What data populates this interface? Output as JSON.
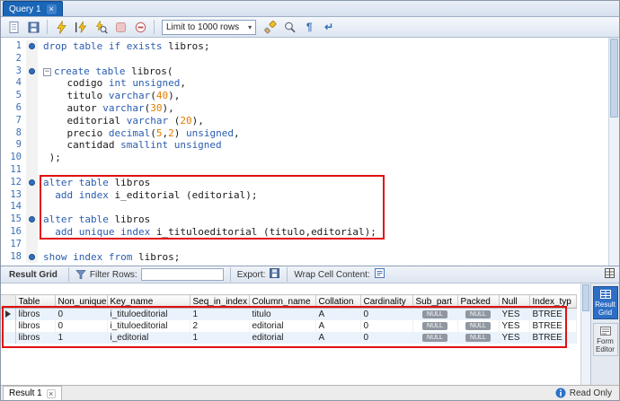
{
  "colors": {
    "accent_blue": "#1a66b8",
    "highlight_red": "#e01010",
    "keyword_blue": "#2a5db0",
    "number_orange": "#e07c00",
    "line_number_blue": "#3a6fb5"
  },
  "icons": {
    "close": "×",
    "chevron_down": "▾",
    "paragraph_mark": "¶",
    "wrap_return": "↵",
    "fold_collapse": "−"
  },
  "tab_bar": {
    "query_tab": "Query 1"
  },
  "toolbar": {
    "limit_value": "Limit to 1000 rows"
  },
  "editor": {
    "lines": [
      {
        "num": "1",
        "dot": true,
        "tokens": [
          [
            "k",
            "drop table if exists "
          ],
          [
            "d",
            "libros"
          ],
          [
            "p",
            ";"
          ]
        ]
      },
      {
        "num": "2",
        "tokens": []
      },
      {
        "num": "3",
        "dot": true,
        "fold": true,
        "tokens": [
          [
            "k",
            "create table "
          ],
          [
            "d",
            "libros"
          ],
          [
            "p",
            "("
          ]
        ]
      },
      {
        "num": "4",
        "tokens": [
          [
            "d",
            "    codigo "
          ],
          [
            "k",
            "int unsigned"
          ],
          [
            "p",
            ","
          ]
        ]
      },
      {
        "num": "5",
        "tokens": [
          [
            "d",
            "    titulo "
          ],
          [
            "k",
            "varchar"
          ],
          [
            "p",
            "("
          ],
          [
            "n",
            "40"
          ],
          [
            "p",
            "),"
          ]
        ]
      },
      {
        "num": "6",
        "tokens": [
          [
            "d",
            "    autor "
          ],
          [
            "k",
            "varchar"
          ],
          [
            "p",
            "("
          ],
          [
            "n",
            "30"
          ],
          [
            "p",
            "),"
          ]
        ]
      },
      {
        "num": "7",
        "tokens": [
          [
            "d",
            "    editorial "
          ],
          [
            "k",
            "varchar"
          ],
          [
            "p",
            " ("
          ],
          [
            "n",
            "20"
          ],
          [
            "p",
            "),"
          ]
        ]
      },
      {
        "num": "8",
        "tokens": [
          [
            "d",
            "    precio "
          ],
          [
            "k",
            "decimal"
          ],
          [
            "p",
            "("
          ],
          [
            "n",
            "5"
          ],
          [
            "p",
            ","
          ],
          [
            "n",
            "2"
          ],
          [
            "p",
            ") "
          ],
          [
            "k",
            "unsigned"
          ],
          [
            "p",
            ","
          ]
        ]
      },
      {
        "num": "9",
        "tokens": [
          [
            "d",
            "    cantidad "
          ],
          [
            "k",
            "smallint unsigned"
          ]
        ]
      },
      {
        "num": "10",
        "tokens": [
          [
            "p",
            " );"
          ]
        ]
      },
      {
        "num": "11",
        "tokens": []
      },
      {
        "num": "12",
        "dot": true,
        "tokens": [
          [
            "k",
            "alter table "
          ],
          [
            "d",
            "libros"
          ]
        ]
      },
      {
        "num": "13",
        "tokens": [
          [
            "p",
            "  "
          ],
          [
            "k",
            "add index "
          ],
          [
            "d",
            "i_editorial"
          ],
          [
            "p",
            " ("
          ],
          [
            "d",
            "editorial"
          ],
          [
            "p",
            ");"
          ]
        ]
      },
      {
        "num": "14",
        "tokens": []
      },
      {
        "num": "15",
        "dot": true,
        "tokens": [
          [
            "k",
            "alter table "
          ],
          [
            "d",
            "libros"
          ]
        ]
      },
      {
        "num": "16",
        "tokens": [
          [
            "p",
            "  "
          ],
          [
            "k",
            "add unique index "
          ],
          [
            "d",
            "i_tituloeditorial"
          ],
          [
            "p",
            " ("
          ],
          [
            "d",
            "titulo"
          ],
          [
            "p",
            ","
          ],
          [
            "d",
            "editorial"
          ],
          [
            "p",
            ");"
          ]
        ]
      },
      {
        "num": "17",
        "tokens": []
      },
      {
        "num": "18",
        "dot": true,
        "tokens": [
          [
            "k",
            "show index from "
          ],
          [
            "d",
            "libros"
          ],
          [
            "p",
            ";"
          ]
        ]
      }
    ]
  },
  "result_toolbar": {
    "grid_label": "Result Grid",
    "filter_label": "Filter Rows:",
    "filter_value": "",
    "export_label": "Export:",
    "wrap_label": "Wrap Cell Content:"
  },
  "result_grid": {
    "columns": [
      "Table",
      "Non_unique",
      "Key_name",
      "Seq_in_index",
      "Column_name",
      "Collation",
      "Cardinality",
      "Sub_part",
      "Packed",
      "Null",
      "Index_typ"
    ],
    "rows": [
      [
        "libros",
        "0",
        "i_tituloeditorial",
        "1",
        "titulo",
        "A",
        "0",
        "NULL",
        "NULL",
        "YES",
        "BTREE"
      ],
      [
        "libros",
        "0",
        "i_tituloeditorial",
        "2",
        "editorial",
        "A",
        "0",
        "NULL",
        "NULL",
        "YES",
        "BTREE"
      ],
      [
        "libros",
        "1",
        "i_editorial",
        "1",
        "editorial",
        "A",
        "0",
        "NULL",
        "NULL",
        "YES",
        "BTREE"
      ]
    ]
  },
  "side_panel": {
    "result_grid_label": "Result Grid",
    "form_editor_label": "Form Editor"
  },
  "status_bar": {
    "result_tab": "Result 1",
    "read_only": "Read Only"
  }
}
